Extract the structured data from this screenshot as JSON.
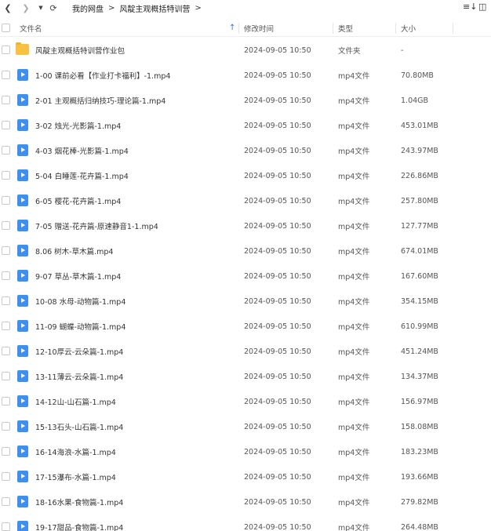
{
  "toolbar": {
    "back_icon": "chevron-left-icon",
    "forward_icon": "chevron-right-icon",
    "history_icon": "caret-down-icon",
    "refresh_icon": "refresh-icon",
    "sort_icon": "sort-icon",
    "view_icon": "grid-view-icon"
  },
  "breadcrumb": {
    "items": [
      "我的网盘",
      "风靛主观概括特训营"
    ],
    "separator": ">"
  },
  "table": {
    "headers": {
      "name": "文件名",
      "modified": "修改时间",
      "type": "类型",
      "size": "大小"
    },
    "sort_indicator": "↑",
    "rows": [
      {
        "name": "风靛主观概括特训营作业包",
        "modified": "2024-09-05 10:50",
        "type": "文件夹",
        "size": "-",
        "icon": "folder-icon"
      },
      {
        "name": "1-00 课前必看【作业打卡福利】-1.mp4",
        "modified": "2024-09-05 10:50",
        "type": "mp4文件",
        "size": "70.80MB",
        "icon": "video-file-icon"
      },
      {
        "name": "2-01 主观概括归纳技巧-理论篇-1.mp4",
        "modified": "2024-09-05 10:50",
        "type": "mp4文件",
        "size": "1.04GB",
        "icon": "video-file-icon"
      },
      {
        "name": "3-02 烛光-光影篇-1.mp4",
        "modified": "2024-09-05 10:50",
        "type": "mp4文件",
        "size": "453.01MB",
        "icon": "video-file-icon"
      },
      {
        "name": "4-03 烟花棒-光影篇-1.mp4",
        "modified": "2024-09-05 10:50",
        "type": "mp4文件",
        "size": "243.97MB",
        "icon": "video-file-icon"
      },
      {
        "name": "5-04 白睡莲-花卉篇-1.mp4",
        "modified": "2024-09-05 10:50",
        "type": "mp4文件",
        "size": "226.86MB",
        "icon": "video-file-icon"
      },
      {
        "name": "6-05 樱花-花卉篇-1.mp4",
        "modified": "2024-09-05 10:50",
        "type": "mp4文件",
        "size": "257.80MB",
        "icon": "video-file-icon"
      },
      {
        "name": "7-05 赠送-花卉篇-原速静音1-1.mp4",
        "modified": "2024-09-05 10:50",
        "type": "mp4文件",
        "size": "127.77MB",
        "icon": "video-file-icon"
      },
      {
        "name": "8.06 树木-草木篇.mp4",
        "modified": "2024-09-05 10:50",
        "type": "mp4文件",
        "size": "674.01MB",
        "icon": "video-file-icon"
      },
      {
        "name": "9-07 草丛-草木篇-1.mp4",
        "modified": "2024-09-05 10:50",
        "type": "mp4文件",
        "size": "167.60MB",
        "icon": "video-file-icon"
      },
      {
        "name": "10-08 水母-动物篇-1.mp4",
        "modified": "2024-09-05 10:50",
        "type": "mp4文件",
        "size": "354.15MB",
        "icon": "video-file-icon"
      },
      {
        "name": "11-09 蝴蝶-动物篇-1.mp4",
        "modified": "2024-09-05 10:50",
        "type": "mp4文件",
        "size": "610.99MB",
        "icon": "video-file-icon"
      },
      {
        "name": "12-10厚云-云朵篇-1.mp4",
        "modified": "2024-09-05 10:50",
        "type": "mp4文件",
        "size": "451.24MB",
        "icon": "video-file-icon"
      },
      {
        "name": "13-11薄云-云朵篇-1.mp4",
        "modified": "2024-09-05 10:50",
        "type": "mp4文件",
        "size": "134.37MB",
        "icon": "video-file-icon"
      },
      {
        "name": "14-12山-山石篇-1.mp4",
        "modified": "2024-09-05 10:50",
        "type": "mp4文件",
        "size": "156.97MB",
        "icon": "video-file-icon"
      },
      {
        "name": "15-13石头-山石篇-1.mp4",
        "modified": "2024-09-05 10:50",
        "type": "mp4文件",
        "size": "158.08MB",
        "icon": "video-file-icon"
      },
      {
        "name": "16-14海浪-水篇-1.mp4",
        "modified": "2024-09-05 10:50",
        "type": "mp4文件",
        "size": "183.23MB",
        "icon": "video-file-icon"
      },
      {
        "name": "17-15瀑布-水篇-1.mp4",
        "modified": "2024-09-05 10:50",
        "type": "mp4文件",
        "size": "193.66MB",
        "icon": "video-file-icon"
      },
      {
        "name": "18-16水果-食物篇-1.mp4",
        "modified": "2024-09-05 10:50",
        "type": "mp4文件",
        "size": "279.82MB",
        "icon": "video-file-icon"
      },
      {
        "name": "19-17甜品-食物篇-1.mp4",
        "modified": "2024-09-05 10:50",
        "type": "mp4文件",
        "size": "264.48MB",
        "icon": "video-file-icon"
      }
    ]
  }
}
